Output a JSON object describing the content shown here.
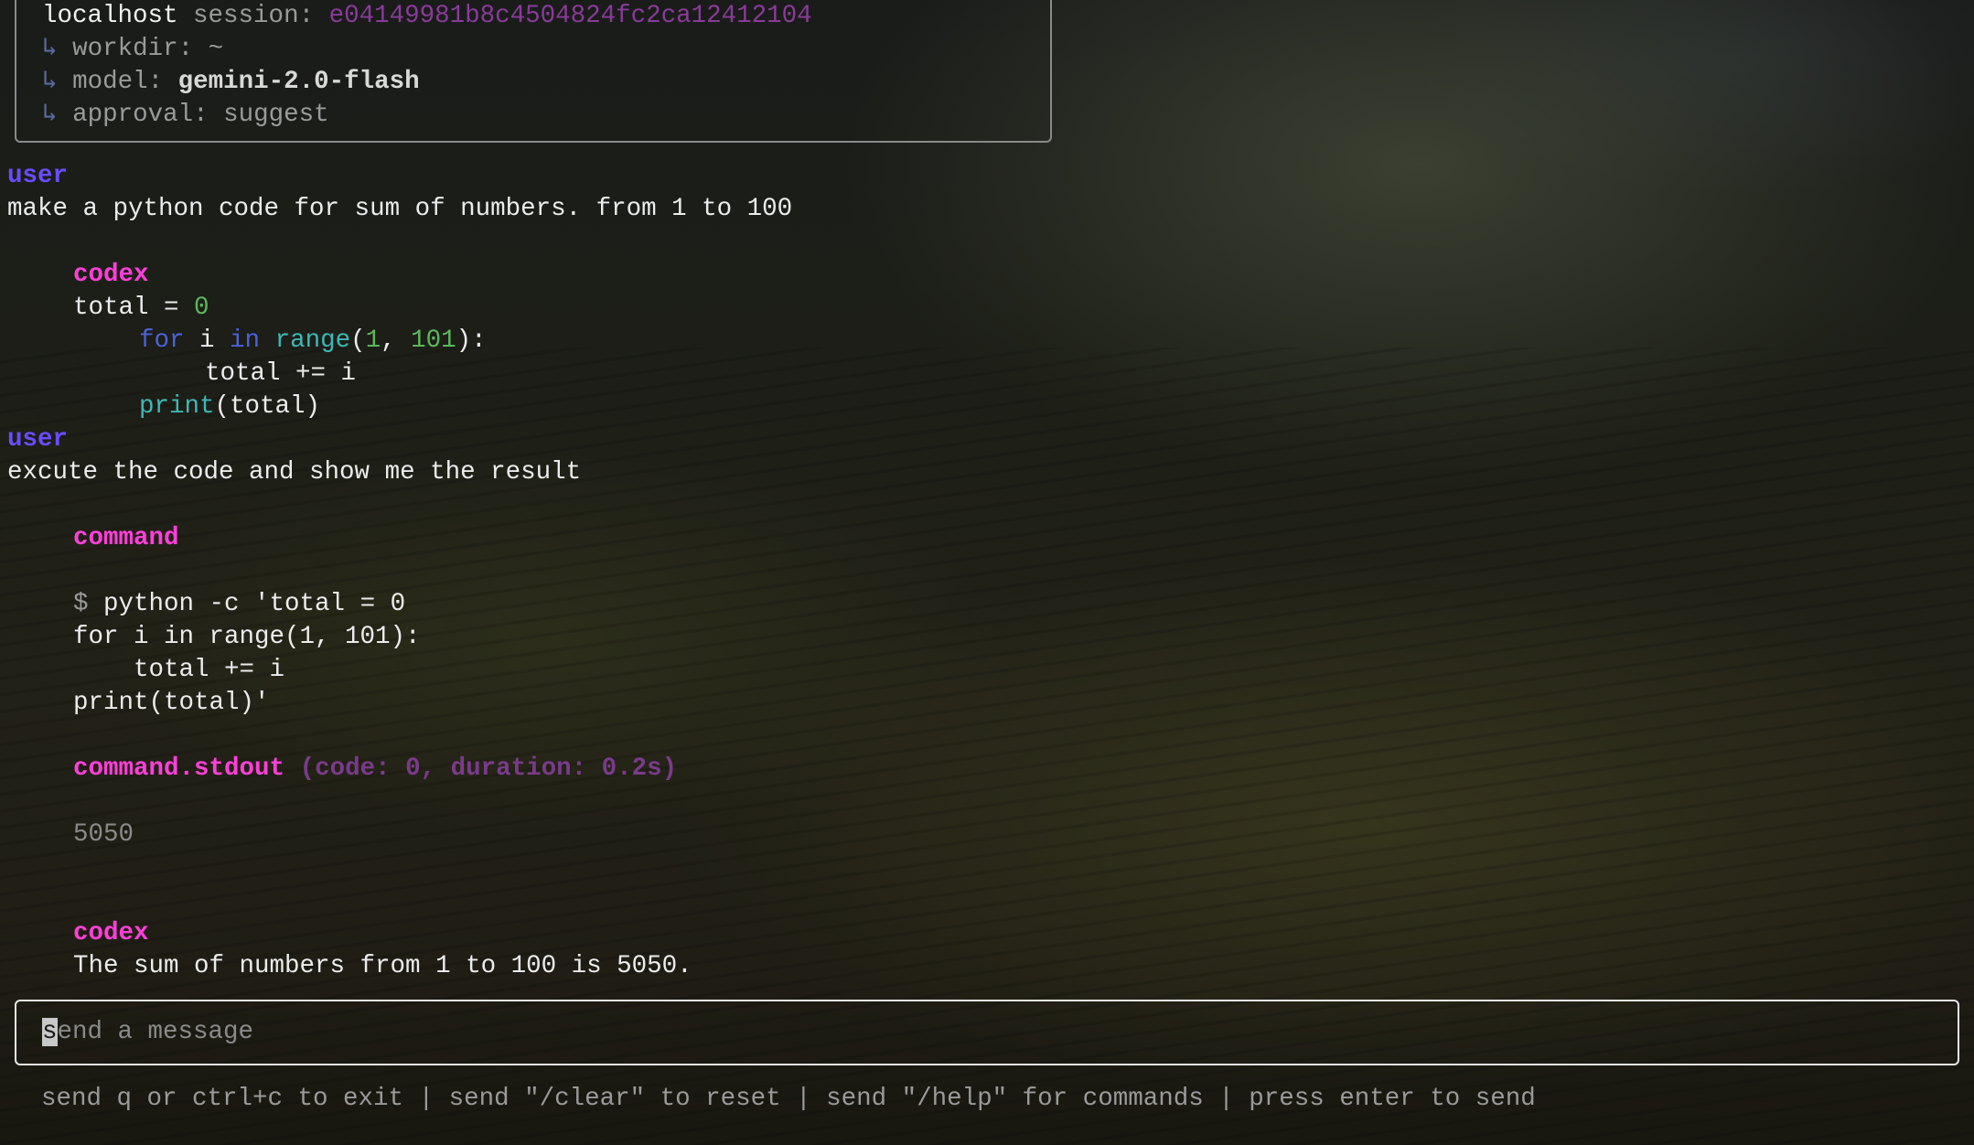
{
  "header": {
    "host": "localhost",
    "session_label": "session:",
    "session_id": "e04149981b8c4504824fc2ca12412104",
    "arrow": "↳",
    "workdir_label": "workdir:",
    "workdir": "~",
    "model_label": "model:",
    "model": "gemini-2.0-flash",
    "approval_label": "approval:",
    "approval": "suggest"
  },
  "messages": {
    "user1": {
      "role": "user",
      "text": "make a python code for sum of numbers. from 1 to 100"
    },
    "codex1": {
      "role": "codex",
      "code": {
        "l1_a": "total = ",
        "l1_num": "0",
        "l2_for": "for",
        "l2_i": " i ",
        "l2_in": "in",
        "l2_space": " ",
        "l2_range": "range",
        "l2_open": "(",
        "l2_n1": "1",
        "l2_comma": ", ",
        "l2_n2": "101",
        "l2_close": "):",
        "l3": "total += i",
        "l4_print": "print",
        "l4_rest": "(total)"
      }
    },
    "user2": {
      "role": "user",
      "text": "excute the code and show me the result"
    },
    "command": {
      "label": "command",
      "prompt": "$",
      "lines": [
        " python -c 'total = 0",
        "for i in range(1, 101):",
        "    total += i",
        "print(total)'"
      ]
    },
    "stdout": {
      "label": "command.stdout",
      "meta": "(code: 0, duration: 0.2s)",
      "output": "5050"
    },
    "codex2": {
      "role": "codex",
      "text": "The sum of numbers from 1 to 100 is 5050."
    }
  },
  "input": {
    "placeholder_first": "s",
    "placeholder_rest": "end a message"
  },
  "footer": {
    "hint": "send q or ctrl+c to exit | send \"/clear\" to reset | send \"/help\" for commands | press enter to send"
  },
  "colors": {
    "user_role": "#6a4cff",
    "codex_role": "#ff3fd9",
    "session_id": "#8a3a9a",
    "keyword": "#4a62d8",
    "builtin": "#3fb7b7",
    "number": "#5cb85c"
  }
}
